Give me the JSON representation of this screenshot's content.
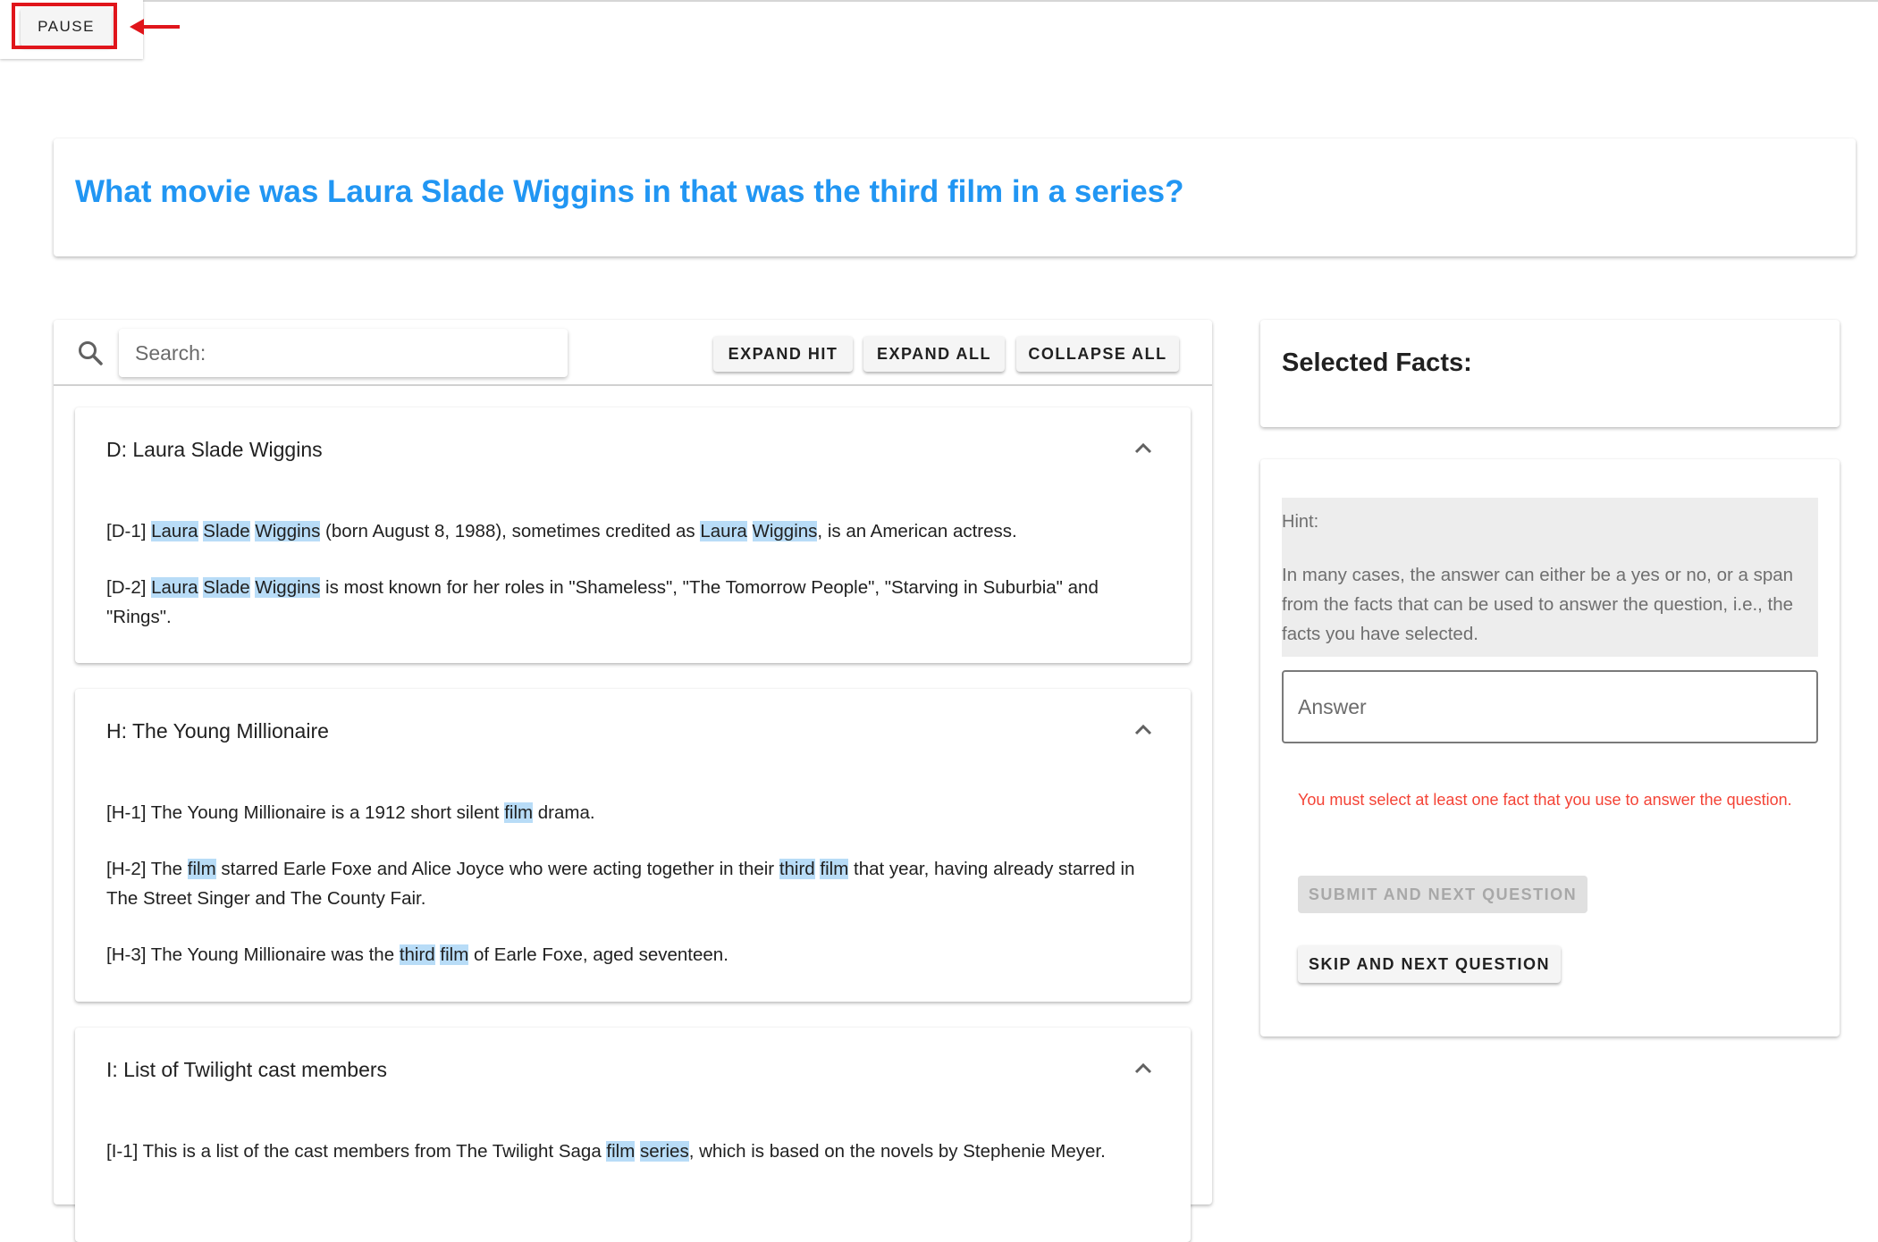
{
  "controls": {
    "pause_label": "PAUSE"
  },
  "question": {
    "text": "What movie was Laura Slade Wiggins in that was the third film in a series?"
  },
  "toolbar": {
    "search_placeholder": "Search:",
    "expand_hit_label": "EXPAND HIT",
    "expand_all_label": "EXPAND ALL",
    "collapse_all_label": "COLLAPSE ALL"
  },
  "documents": [
    {
      "title": "D: Laura Slade Wiggins",
      "facts": [
        [
          "[D-1] ",
          {
            "hl": "Laura"
          },
          " ",
          {
            "hl": "Slade"
          },
          " ",
          {
            "hl": "Wiggins"
          },
          " (born August 8, 1988), sometimes credited as ",
          {
            "hl": "Laura"
          },
          " ",
          {
            "hl": "Wiggins"
          },
          ", is an American actress."
        ],
        [
          "[D-2] ",
          {
            "hl": "Laura"
          },
          " ",
          {
            "hl": "Slade"
          },
          " ",
          {
            "hl": "Wiggins"
          },
          " is most known for her roles in \"Shameless\", \"The Tomorrow People\", \"Starving in Suburbia\" and \"Rings\"."
        ]
      ]
    },
    {
      "title": "H: The Young Millionaire",
      "facts": [
        [
          "[H-1] The Young Millionaire is a 1912 short silent ",
          {
            "hl": "film"
          },
          " drama."
        ],
        [
          "[H-2] The ",
          {
            "hl": "film"
          },
          " starred Earle Foxe and Alice Joyce who were acting together in their ",
          {
            "hl": "third"
          },
          " ",
          {
            "hl": "film"
          },
          " that year, having already starred in The Street Singer and The County Fair."
        ],
        [
          "[H-3] The Young Millionaire was the ",
          {
            "hl": "third"
          },
          " ",
          {
            "hl": "film"
          },
          " of Earle Foxe, aged seventeen."
        ]
      ]
    },
    {
      "title": "I: List of Twilight cast members",
      "facts": [
        [
          "[I-1] This is a list of the cast members from The Twilight Saga ",
          {
            "hl": "film"
          },
          " ",
          {
            "hl": "series"
          },
          ", which is based on the novels by Stephenie Meyer."
        ]
      ]
    }
  ],
  "sidebar": {
    "selected_title": "Selected Facts:",
    "hint_label": "Hint:",
    "hint_text": "In many cases, the answer can either be a yes or no, or a span from the facts that can be used to answer the question, i.e., the facts you have selected.",
    "answer_placeholder": "Answer",
    "error_text": "You must select at least one fact that you use to answer the question.",
    "submit_label": "SUBMIT AND NEXT QUESTION",
    "skip_label": "SKIP AND NEXT QUESTION"
  },
  "colors": {
    "question": "#2196f3",
    "highlight": "#b8dcf7",
    "error": "#f44336",
    "annotation_frame": "#e0151b"
  },
  "icons": [
    "search-icon",
    "chevron-up-icon",
    "arrow-left-icon"
  ]
}
